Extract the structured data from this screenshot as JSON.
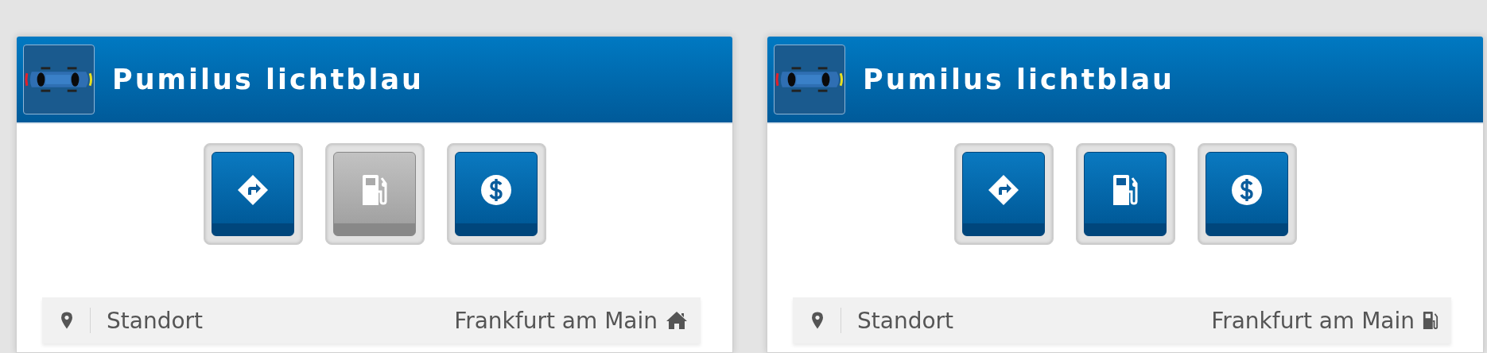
{
  "cards": [
    {
      "title": "Pumilus lichtblau",
      "buttons": [
        {
          "kind": "directions",
          "disabled": false
        },
        {
          "kind": "fuel",
          "disabled": true
        },
        {
          "kind": "money",
          "disabled": false
        }
      ],
      "location": {
        "label": "Standort",
        "value": "Frankfurt am Main",
        "kind": "home"
      }
    },
    {
      "title": "Pumilus lichtblau",
      "buttons": [
        {
          "kind": "directions",
          "disabled": false
        },
        {
          "kind": "fuel",
          "disabled": false
        },
        {
          "kind": "money",
          "disabled": false
        }
      ],
      "location": {
        "label": "Standort",
        "value": "Frankfurt am Main",
        "kind": "fuel"
      }
    }
  ]
}
